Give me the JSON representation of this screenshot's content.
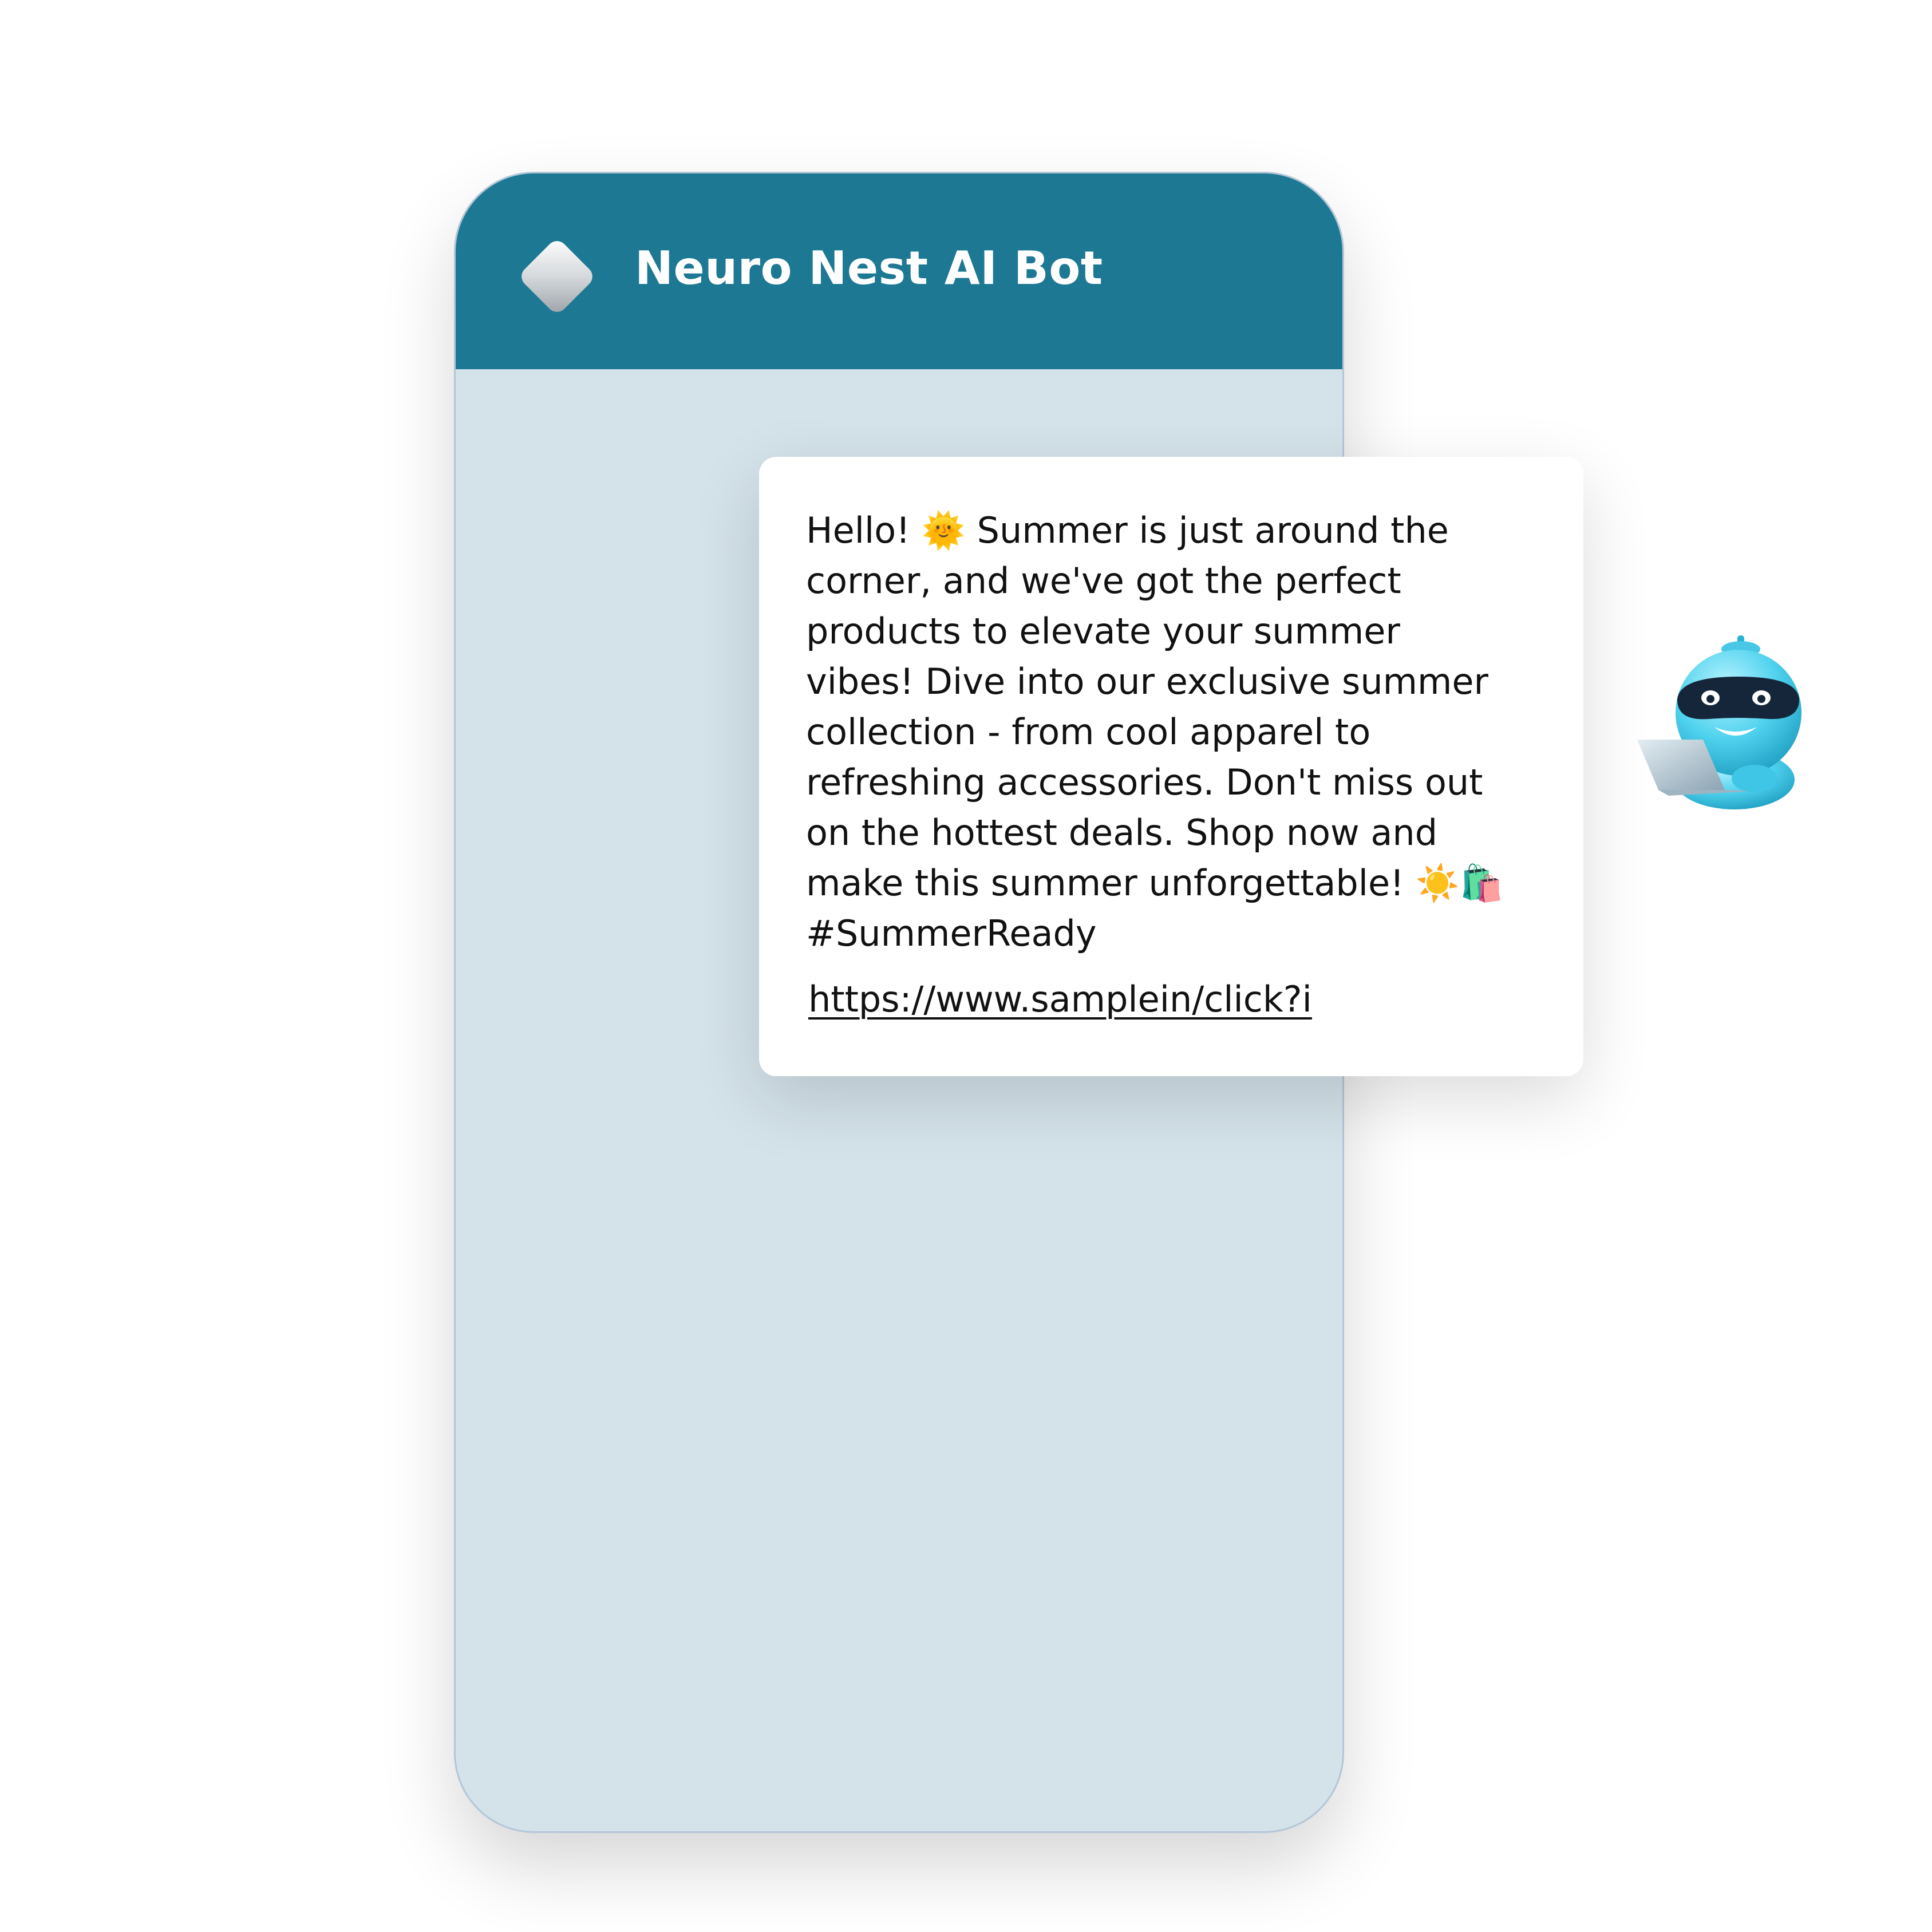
{
  "header": {
    "title": "Neuro Nest AI Bot",
    "logo_icon": "diamond-logo-icon",
    "background_color": "#1d7893"
  },
  "message": {
    "text": "Hello! 🌞 Summer is just around the\ncorner, and we've got the perfect\nproducts to elevate your summer\nvibes! Dive into our exclusive summer\ncollection - from cool apparel to\nrefreshing accessories. Don't miss out\non the hottest deals. Shop now and\nmake this summer unforgettable! ☀️🛍️\n#SummerReady",
    "link": "https://www.samplein/click?i"
  },
  "mascot": {
    "icon": "robot-with-laptop-icon"
  },
  "colors": {
    "chat_background": "#d4e2ea",
    "card_background": "#ffffff",
    "robot_body": "#4fd2ee"
  }
}
